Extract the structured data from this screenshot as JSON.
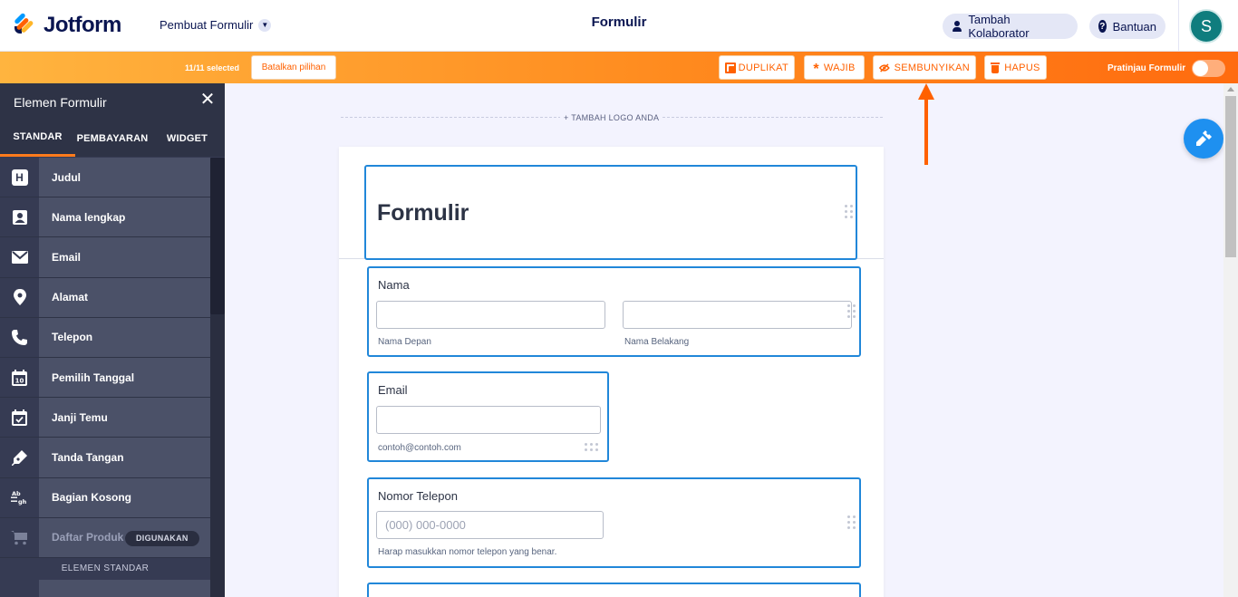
{
  "header": {
    "logo_text": "Jotform",
    "builder_label": "Pembuat Formulir",
    "page_title": "Formulir",
    "collaborator_label": "Tambah Kolaborator",
    "help_label": "Bantuan",
    "avatar_initial": "S"
  },
  "toolbar": {
    "selected_count": "11/11 selected",
    "cancel_label": "Batalkan pilihan",
    "duplicate_label": "DUPLIKAT",
    "required_label": "WAJIB",
    "hide_label": "SEMBUNYIKAN",
    "delete_label": "HAPUS",
    "preview_label": "Pratinjau Formulir",
    "accent_color": "#ff7b1c"
  },
  "sidebar": {
    "title": "Elemen Formulir",
    "tabs": [
      {
        "label": "STANDAR"
      },
      {
        "label": "PEMBAYARAN"
      },
      {
        "label": "WIDGET"
      }
    ],
    "items": [
      {
        "label": "Judul",
        "icon": "heading-icon"
      },
      {
        "label": "Nama lengkap",
        "icon": "contact-card-icon"
      },
      {
        "label": "Email",
        "icon": "envelope-icon"
      },
      {
        "label": "Alamat",
        "icon": "location-pin-icon"
      },
      {
        "label": "Telepon",
        "icon": "phone-icon"
      },
      {
        "label": "Pemilih Tanggal",
        "icon": "calendar-icon"
      },
      {
        "label": "Janji Temu",
        "icon": "calendar-check-icon"
      },
      {
        "label": "Tanda Tangan",
        "icon": "pen-icon"
      },
      {
        "label": "Bagian Kosong",
        "icon": "blank-text-icon"
      },
      {
        "label": "Daftar Produk",
        "icon": "cart-icon",
        "badge": "DIGUNAKAN"
      }
    ],
    "section_label": "ELEMEN STANDAR"
  },
  "canvas": {
    "add_logo_label": "+ TAMBAH LOGO ANDA",
    "form_heading": "Formulir",
    "name_field": {
      "label": "Nama",
      "first_sublabel": "Nama Depan",
      "last_sublabel": "Nama Belakang"
    },
    "email_field": {
      "label": "Email",
      "sublabel": "contoh@contoh.com"
    },
    "phone_field": {
      "label": "Nomor Telepon",
      "placeholder": "(000) 000-0000",
      "sublabel": "Harap masukkan nomor telepon yang benar."
    }
  }
}
